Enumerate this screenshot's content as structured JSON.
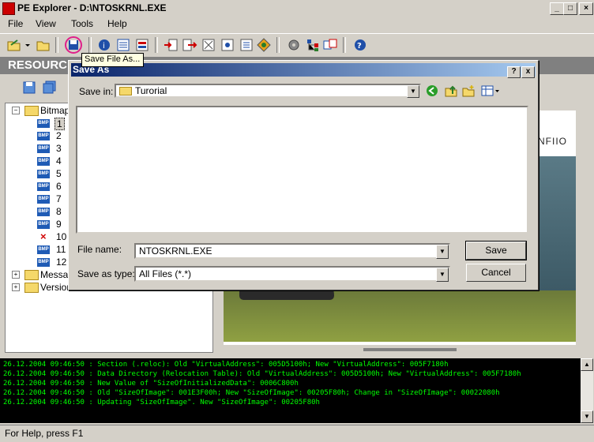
{
  "app": {
    "title": "PE Explorer - D:\\NTOSKRNL.EXE",
    "menu": [
      "File",
      "View",
      "Tools",
      "Help"
    ],
    "band_title": "RESOURC"
  },
  "tooltip": "Save File As...",
  "tree": {
    "root": "Bitmap",
    "items": [
      "1",
      "2",
      "3",
      "4",
      "5",
      "6",
      "7",
      "8",
      "9",
      "10",
      "11",
      "12"
    ],
    "others": [
      "Messag",
      "Version"
    ]
  },
  "image_text": "NFIIO",
  "dialog": {
    "title": "Save As",
    "save_in_label": "Save in:",
    "save_in_value": "Turorial",
    "file_name_label": "File name:",
    "file_name_value": "NTOSKRNL.EXE",
    "save_as_type_label": "Save as type:",
    "save_as_type_value": "All Files (*.*)",
    "save_button": "Save",
    "cancel_button": "Cancel",
    "help_button": "?",
    "close_button": "x"
  },
  "log": [
    "26.12.2004 09:46:50 : Section (.reloc):  Old \"VirtualAddress\": 005D5100h; New \"VirtualAddress\": 005F7180h",
    "26.12.2004 09:46:50 : Data Directory (Relocation Table):  Old \"VirtualAddress\": 005D5100h; New \"VirtualAddress\": 005F7180h",
    "26.12.2004 09:46:50 : New Value of \"SizeOfInitializedData\": 0006C800h",
    "26.12.2004 09:46:50 : Old \"SizeOfImage\": 001E3F00h; New \"SizeOfImage\": 00205F80h; Change in \"SizeOfImage\": 00022080h",
    "26.12.2004 09:46:50 : Updating \"SizeOfImage\". New \"SizeOfImage\": 00205F80h"
  ],
  "status": "For Help, press F1"
}
